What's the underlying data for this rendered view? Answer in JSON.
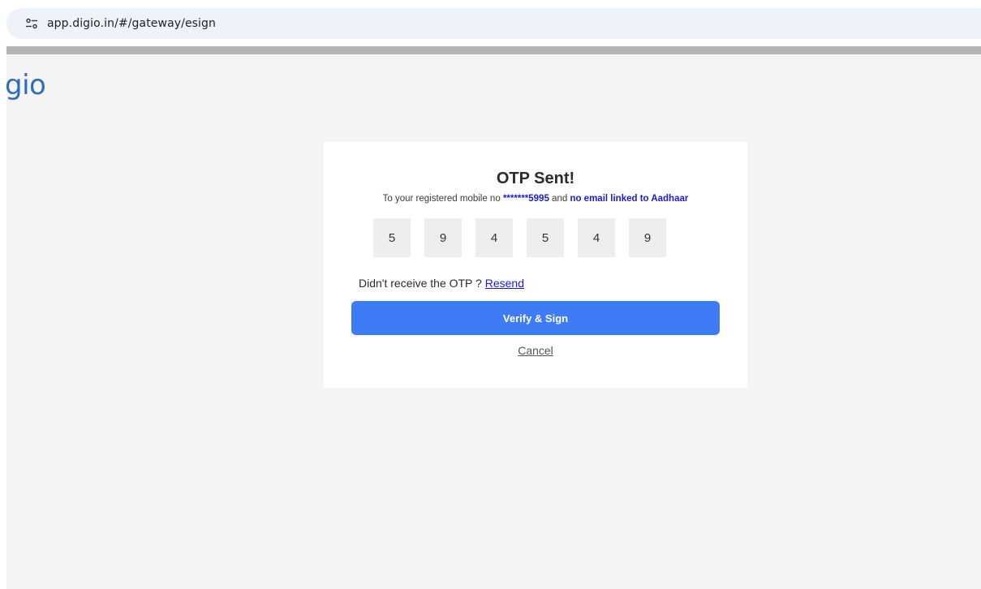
{
  "browser": {
    "url": "app.digio.in/#/gateway/esign",
    "site_info_icon": "tune-icon"
  },
  "page": {
    "logo_text": "gio"
  },
  "otp_card": {
    "title": "OTP Sent!",
    "subtitle_prefix": "To your registered mobile no ",
    "masked_mobile": "*******5995",
    "subtitle_middle": " and ",
    "email_status": "no email linked to Aadhaar",
    "otp_digits": [
      "5",
      "9",
      "4",
      "5",
      "4",
      "9"
    ],
    "resend_prompt": "Didn't receive the OTP ? ",
    "resend_label": "Resend",
    "verify_label": "Verify & Sign",
    "cancel_label": "Cancel"
  },
  "colors": {
    "accent": "#3d7bf7",
    "link": "#1a1adb",
    "logo": "#2a6ebd",
    "page_bg": "#f4f4f4"
  }
}
